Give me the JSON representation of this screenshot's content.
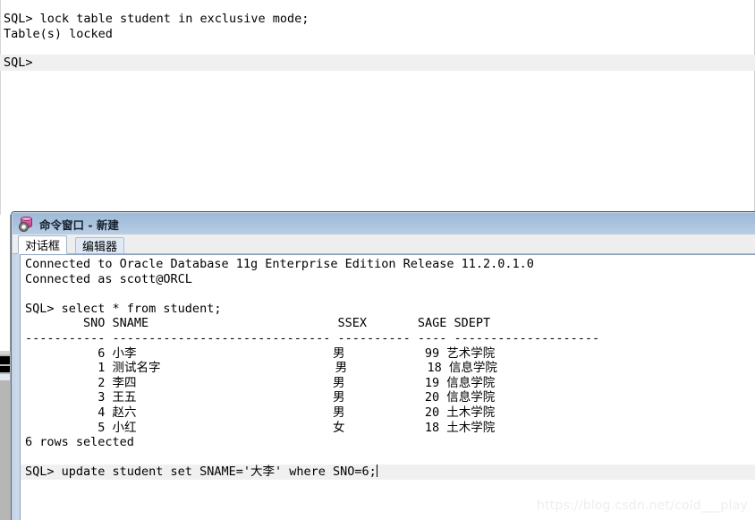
{
  "background_console": {
    "lines": [
      "SQL> lock table student in exclusive mode;",
      "Table(s) locked"
    ],
    "prompt_line": "SQL>"
  },
  "command_window": {
    "icon": "database-gear-icon",
    "title": "命令窗口 - 新建",
    "tabs": [
      {
        "label": "对话框",
        "active": true
      },
      {
        "label": "编辑器",
        "active": false
      }
    ],
    "console": {
      "lines": [
        {
          "text": "Connected to Oracle Database 11g Enterprise Edition Release 11.2.0.1.0",
          "highlight": false
        },
        {
          "text": "Connected as scott@ORCL",
          "highlight": false
        },
        {
          "text": "",
          "highlight": false
        },
        {
          "text": "SQL> select * from student;",
          "highlight": false
        },
        {
          "text": "        SNO SNAME                          SSEX       SAGE SDEPT",
          "highlight": false
        },
        {
          "text": "----------- ------------------------------ ---------- ---- --------------------",
          "highlight": false
        },
        {
          "text": "          6 小李                           男           99 艺术学院",
          "highlight": false
        },
        {
          "text": "          1 测试名字                        男           18 信息学院",
          "highlight": false
        },
        {
          "text": "          2 李四                           男           19 信息学院",
          "highlight": false
        },
        {
          "text": "          3 王五                           男           20 信息学院",
          "highlight": false
        },
        {
          "text": "          4 赵六                           男           20 土木学院",
          "highlight": false
        },
        {
          "text": "          5 小红                           女           18 土木学院",
          "highlight": false
        },
        {
          "text": "6 rows selected",
          "highlight": false
        },
        {
          "text": "",
          "highlight": false
        },
        {
          "text": "SQL> update student set SNAME='大李' where SNO=6;",
          "highlight": true,
          "caret": true
        }
      ]
    },
    "query_result": {
      "statement": "select * from student;",
      "columns": [
        "SNO",
        "SNAME",
        "SSEX",
        "SAGE",
        "SDEPT"
      ],
      "rows": [
        {
          "SNO": "6",
          "SNAME": "小李",
          "SSEX": "男",
          "SAGE": "99",
          "SDEPT": "艺术学院"
        },
        {
          "SNO": "1",
          "SNAME": "测试名字",
          "SSEX": "男",
          "SAGE": "18",
          "SDEPT": "信息学院"
        },
        {
          "SNO": "2",
          "SNAME": "李四",
          "SSEX": "男",
          "SAGE": "19",
          "SDEPT": "信息学院"
        },
        {
          "SNO": "3",
          "SNAME": "王五",
          "SSEX": "男",
          "SAGE": "20",
          "SDEPT": "信息学院"
        },
        {
          "SNO": "4",
          "SNAME": "赵六",
          "SSEX": "男",
          "SAGE": "20",
          "SDEPT": "土木学院"
        },
        {
          "SNO": "5",
          "SNAME": "小红",
          "SSEX": "女",
          "SAGE": "18",
          "SDEPT": "土木学院"
        }
      ],
      "row_count_text": "6 rows selected",
      "pending_statement": "update student set SNAME='大李' where SNO=6;"
    }
  },
  "watermark": {
    "text": "https://blog.csdn.net/cold___play"
  },
  "colors": {
    "titlebar_top": "#9fbbd8",
    "titlebar_bottom": "#b9cee5",
    "window_frame": "#cbdaea",
    "tab_active_bg": "#ffffff",
    "tab_inactive_bg": "#dfeaf6",
    "console_bg": "#ffffff",
    "prompt_highlight": "#f0f0f0",
    "text": "#000000",
    "watermark": "#eceef0"
  }
}
